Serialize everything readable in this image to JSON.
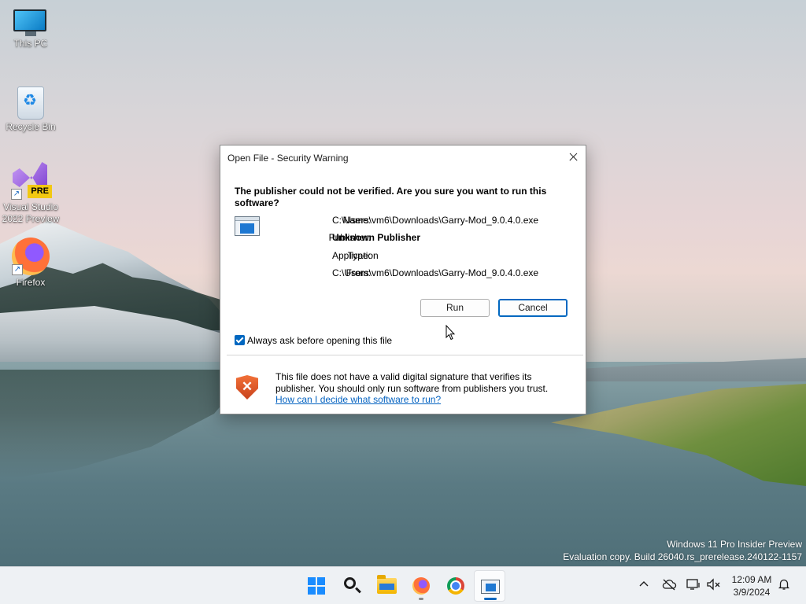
{
  "desktop": {
    "icons": [
      {
        "label": "This PC"
      },
      {
        "label": "Recycle Bin"
      },
      {
        "label": "Visual Studio 2022 Preview",
        "badge": "PRE"
      },
      {
        "label": "Firefox"
      }
    ],
    "watermark": {
      "line1": "Windows 11 Pro Insider Preview",
      "line2": "Evaluation copy. Build 26040.rs_prerelease.240122-1157"
    }
  },
  "dialog": {
    "title": "Open File - Security Warning",
    "headline": "The publisher could not be verified.  Are you sure you want to run this software?",
    "rows": [
      {
        "label": "Name:",
        "value": "C:\\Users\\vm6\\Downloads\\Garry-Mod_9.0.4.0.exe"
      },
      {
        "label": "Publisher:",
        "value": "Unknown Publisher"
      },
      {
        "label": "Type:",
        "value": "Application"
      },
      {
        "label": "From:",
        "value": "C:\\Users\\vm6\\Downloads\\Garry-Mod_9.0.4.0.exe"
      }
    ],
    "run_label": "Run",
    "cancel_label": "Cancel",
    "checkbox_label": "Always ask before opening this file",
    "checkbox_checked": true,
    "warning_text": "This file does not have a valid digital signature that verifies its publisher.  You should only run software from publishers you trust.",
    "warning_link": "How can I decide what software to run?"
  },
  "taskbar": {
    "apps": [
      {
        "icon": "windows-start-icon"
      },
      {
        "icon": "search-icon"
      },
      {
        "icon": "file-explorer-icon"
      },
      {
        "icon": "firefox-icon"
      },
      {
        "icon": "chrome-icon"
      },
      {
        "icon": "security-warning-app-icon"
      }
    ],
    "tray": [
      "chevron-up-icon",
      "onedrive-offline-icon",
      "network-icon",
      "volume-muted-icon",
      "notification-bell-icon"
    ],
    "clock": {
      "time": "12:09 AM",
      "date": "3/9/2024"
    }
  },
  "colors": {
    "accent": "#0067c0",
    "link": "#0563c1",
    "shield": "#e2552a"
  }
}
